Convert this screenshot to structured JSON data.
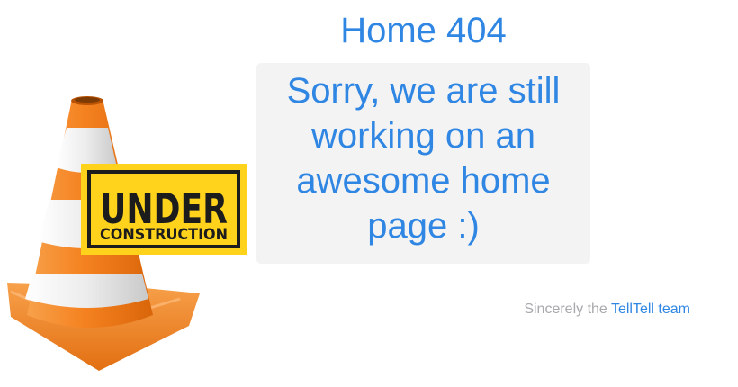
{
  "page": {
    "title": "Home 404",
    "message": "Sorry, we are still working on an awesome home page :)"
  },
  "sign": {
    "line1": "UNDER",
    "line2": "CONSTRUCTION"
  },
  "signature": {
    "prefix": "Sincerely the ",
    "team": "TellTell team"
  },
  "icons": [
    "traffic-cone-icon",
    "under-construction-sign"
  ],
  "colors": {
    "accent": "#2f86e3",
    "muted": "#a8a8ad",
    "box_bg": "#f3f3f4",
    "cone_orange": "#f58220",
    "cone_stripe": "#e9e9e9",
    "sign_yellow": "#ffd21c"
  }
}
